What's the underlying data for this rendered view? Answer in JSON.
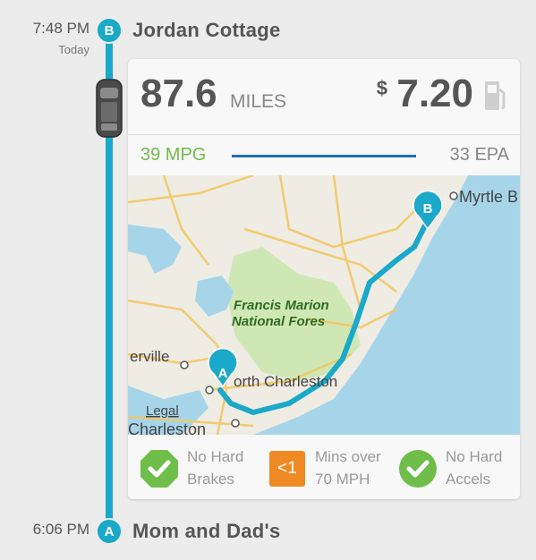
{
  "trip": {
    "end": {
      "time": "7:48 PM",
      "day": "Today",
      "badge": "B",
      "name": "Jordan Cottage"
    },
    "start": {
      "time": "6:06 PM",
      "badge": "A",
      "name": "Mom and Dad's"
    }
  },
  "card": {
    "distance_value": "87.6",
    "distance_unit": "MILES",
    "cost_symbol": "$",
    "cost_value": "7.20",
    "mpg": "39 MPG",
    "epa": "33 EPA",
    "mpg_bar_color": "#1f6fb5"
  },
  "map": {
    "labels": {
      "myrtle": "Myrtle B",
      "forest1": "Francis Marion",
      "forest2": "National Fores",
      "nc": "orth Charleston",
      "erville": "erville",
      "legal": "Legal",
      "charleston": "Charleston"
    },
    "pin_a": "A",
    "pin_b": "B",
    "route_color": "#1aa9c8",
    "water_color": "#a6d5ea"
  },
  "stats": [
    {
      "icon": "check-octagon-icon",
      "line1": "No Hard",
      "line2": "Brakes"
    },
    {
      "icon": "less-than-one-badge",
      "badge_text": "<1",
      "line1": "Mins over",
      "line2": "70 MPH"
    },
    {
      "icon": "check-circle-icon",
      "line1": "No Hard",
      "line2": "Accels"
    }
  ],
  "colors": {
    "accent": "#1aa9c8",
    "good": "#6fbe4a",
    "warn": "#f08a24"
  }
}
